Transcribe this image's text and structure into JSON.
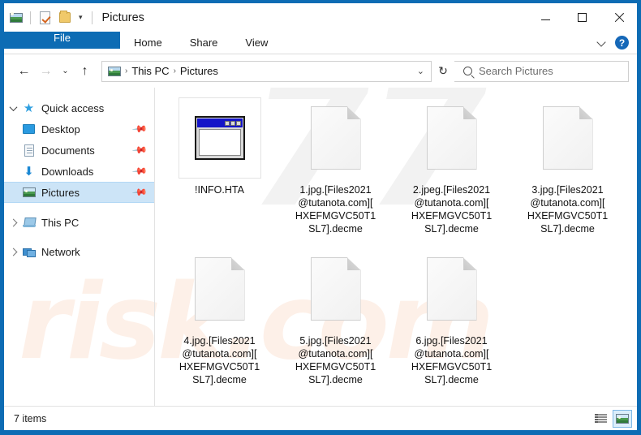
{
  "window": {
    "title": "Pictures",
    "quick_access_toolbar": [
      {
        "name": "pictures-folder-icon",
        "label": "Pictures"
      },
      {
        "name": "properties-icon",
        "label": "Properties"
      },
      {
        "name": "new-folder-icon",
        "label": "New folder"
      },
      {
        "name": "customize-dropdown-icon",
        "label": "Customize Quick Access Toolbar"
      }
    ],
    "controls": {
      "minimize": "—",
      "maximize": "□",
      "close": "×"
    }
  },
  "ribbon": {
    "tabs": [
      {
        "label": "File",
        "active": true
      },
      {
        "label": "Home",
        "active": false
      },
      {
        "label": "Share",
        "active": false
      },
      {
        "label": "View",
        "active": false
      }
    ],
    "collapse_label": "Minimize the Ribbon",
    "help_label": "?"
  },
  "address": {
    "back": "←",
    "forward": "→",
    "recent": "⌄",
    "up": "↑",
    "breadcrumbs": [
      "This PC",
      "Pictures"
    ],
    "separator": "›",
    "dropdown": "⌄",
    "refresh": "↻"
  },
  "search": {
    "placeholder": "Search Pictures",
    "value": ""
  },
  "sidebar": {
    "items": [
      {
        "label": "Quick access",
        "icon": "star-icon",
        "twisty": "expanded",
        "indent": false,
        "pinned": false,
        "selected": false
      },
      {
        "label": "Desktop",
        "icon": "desktop-icon",
        "twisty": "none",
        "indent": true,
        "pinned": true,
        "selected": false
      },
      {
        "label": "Documents",
        "icon": "documents-icon",
        "twisty": "none",
        "indent": true,
        "pinned": true,
        "selected": false
      },
      {
        "label": "Downloads",
        "icon": "downloads-icon",
        "twisty": "none",
        "indent": true,
        "pinned": true,
        "selected": false
      },
      {
        "label": "Pictures",
        "icon": "pictures-icon",
        "twisty": "none",
        "indent": true,
        "pinned": true,
        "selected": true
      },
      {
        "label": "This PC",
        "icon": "this-pc-icon",
        "twisty": "collapsed",
        "indent": false,
        "pinned": false,
        "selected": false
      },
      {
        "label": "Network",
        "icon": "network-icon",
        "twisty": "collapsed",
        "indent": false,
        "pinned": false,
        "selected": false
      }
    ],
    "pin_glyph": "📌"
  },
  "files": [
    {
      "name": "!INFO.HTA",
      "icon": "hta-application-icon",
      "selected": true
    },
    {
      "name": "1.jpg.[Files2021\n@tutanota.com][\nHXEFMGVC50T1\nSL7].decme",
      "icon": "blank-document-icon",
      "selected": false
    },
    {
      "name": "2.jpeg.[Files2021\n@tutanota.com][\nHXEFMGVC50T1\nSL7].decme",
      "icon": "blank-document-icon",
      "selected": false
    },
    {
      "name": "3.jpg.[Files2021\n@tutanota.com][\nHXEFMGVC50T1\nSL7].decme",
      "icon": "blank-document-icon",
      "selected": false
    },
    {
      "name": "4.jpg.[Files2021\n@tutanota.com][\nHXEFMGVC50T1\nSL7].decme",
      "icon": "blank-document-icon",
      "selected": false
    },
    {
      "name": "5.jpg.[Files2021\n@tutanota.com][\nHXEFMGVC50T1\nSL7].decme",
      "icon": "blank-document-icon",
      "selected": false
    },
    {
      "name": "6.jpg.[Files2021\n@tutanota.com][\nHXEFMGVC50T1\nSL7].decme",
      "icon": "blank-document-icon",
      "selected": false
    }
  ],
  "status": {
    "item_count": "7 items",
    "views": [
      {
        "name": "details-view-button",
        "label": "Details view",
        "active": false
      },
      {
        "name": "large-icons-view-button",
        "label": "Large icons view",
        "active": true
      }
    ]
  },
  "watermark": {
    "gray_text": "77",
    "peach_text": "risk.com"
  },
  "colors": {
    "window_border": "#0d6cb4",
    "file_tab": "#0d6cb4",
    "selection": "#cce4f7",
    "help_badge": "#1668b8",
    "hta_titlebar": "#1414c8"
  }
}
